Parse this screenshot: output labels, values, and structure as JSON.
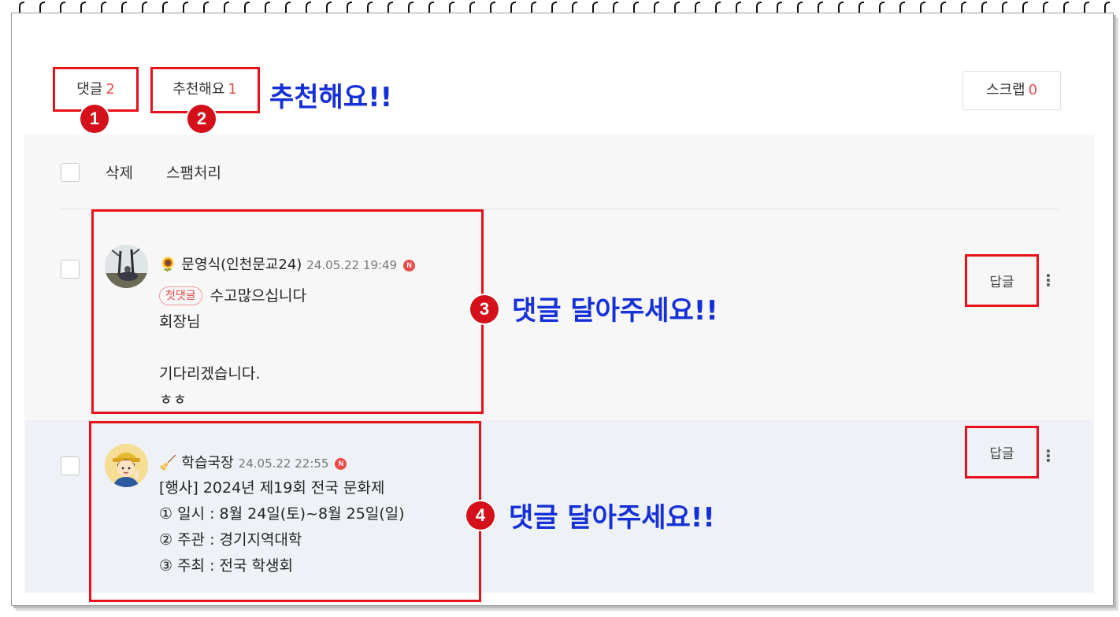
{
  "tabs": {
    "comments_label": "댓글",
    "comments_count": "2",
    "likes_label": "추천해요",
    "likes_count": "1",
    "scrap_label": "스크랩",
    "scrap_count": "0"
  },
  "bulk_actions": {
    "delete": "삭제",
    "spam": "스팸처리"
  },
  "annotations": {
    "badge1": "1",
    "badge2": "2",
    "badge3": "3",
    "badge4": "4",
    "callout_like": "추천해요!!",
    "callout_reply1": "댓글 달아주세요!!",
    "callout_reply2": "댓글 달아주세요!!"
  },
  "comments": [
    {
      "icon": "🌻",
      "author": "문영식(인천문교24)",
      "date": "24.05.22 19:49",
      "new_badge": "N",
      "first_tag": "첫댓글",
      "first_line": "수고많으십니다",
      "body": "회장님\n\n기다리겠습니다.\nㅎㅎ",
      "reply_label": "답글",
      "more": "⋮"
    },
    {
      "icon": "🧹",
      "author": "학습국장",
      "date": "24.05.22 22:55",
      "new_badge": "N",
      "body": "[행사] 2024년 제19회 전국 문화제\n① 일시 : 8월 24일(토)~8월 25일(일)\n② 주관 : 경기지역대학\n③ 주최 : 전국 학생회",
      "reply_label": "답글",
      "more": "⋮"
    }
  ],
  "colors": {
    "highlight_red": "#e8101a",
    "callout_blue": "#1530d8",
    "count_red": "#e84a4a"
  }
}
